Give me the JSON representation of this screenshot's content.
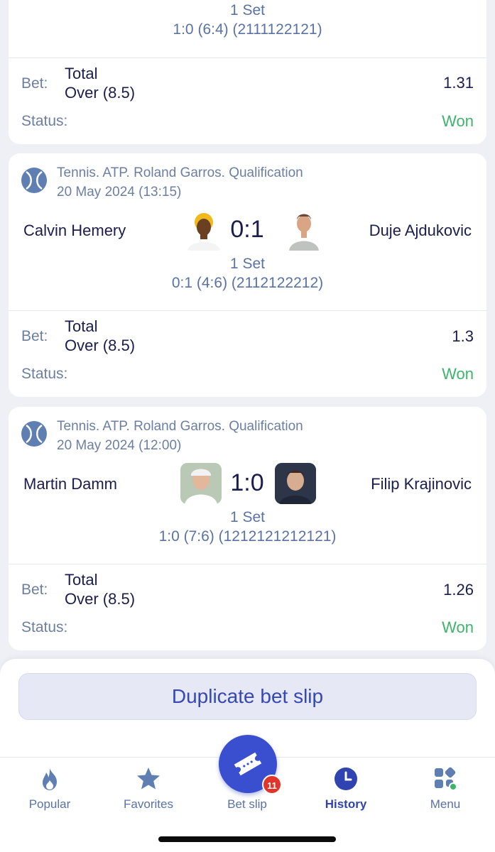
{
  "card0": {
    "set_label": "1 Set",
    "set_detail": "1:0 (6:4) (2111122121)",
    "bet_label": "Bet:",
    "bet_line1": "Total",
    "bet_line2": "Over (8.5)",
    "odds": "1.31",
    "status_label": "Status:",
    "status_value": "Won"
  },
  "card1": {
    "league": "Tennis. ATP. Roland Garros. Qualification",
    "date": "20 May 2024 (13:15)",
    "player1": "Calvin Hemery",
    "player2": "Duje Ajdukovic",
    "score": "0:1",
    "set_label": "1 Set",
    "set_detail": "0:1 (4:6) (2112122212)",
    "bet_label": "Bet:",
    "bet_line1": "Total",
    "bet_line2": "Over (8.5)",
    "odds": "1.3",
    "status_label": "Status:",
    "status_value": "Won"
  },
  "card2": {
    "league": "Tennis. ATP. Roland Garros. Qualification",
    "date": "20 May 2024 (12:00)",
    "player1": "Martin Damm",
    "player2": "Filip Krajinovic",
    "score": "1:0",
    "set_label": "1 Set",
    "set_detail": "1:0 (7:6) (1212121212121)",
    "bet_label": "Bet:",
    "bet_line1": "Total",
    "bet_line2": "Over (8.5)",
    "odds": "1.26",
    "status_label": "Status:",
    "status_value": "Won"
  },
  "actions": {
    "duplicate_label": "Duplicate bet slip"
  },
  "tabbar": {
    "popular": "Popular",
    "favorites": "Favorites",
    "bet_slip": "Bet slip",
    "bet_slip_badge": "11",
    "history": "History",
    "menu": "Menu"
  },
  "colors": {
    "accent": "#3a4fd0",
    "won": "#3cb46c",
    "muted": "#6c7fa3",
    "badge": "#e3342b"
  }
}
